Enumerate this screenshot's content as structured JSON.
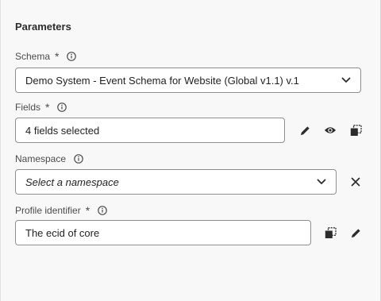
{
  "panel": {
    "heading": "Parameters"
  },
  "schema": {
    "label": "Schema",
    "required_mark": "*",
    "value": "Demo System - Event Schema for Website (Global v1.1) v.1",
    "icons": [
      "info-icon",
      "chevron-down-icon"
    ]
  },
  "fields": {
    "label": "Fields",
    "required_mark": "*",
    "value": "4 fields selected",
    "icons": [
      "info-icon",
      "pencil-icon",
      "eye-icon",
      "copy-icon"
    ]
  },
  "namespace": {
    "label": "Namespace",
    "placeholder": "Select a namespace",
    "icons": [
      "info-icon",
      "chevron-down-icon",
      "close-icon"
    ]
  },
  "profile_identifier": {
    "label": "Profile identifier",
    "required_mark": "*",
    "value": "The ecid of core",
    "icons": [
      "info-icon",
      "copy-icon",
      "pencil-icon"
    ]
  },
  "colors": {
    "background": "#f8f8f8",
    "field_border": "#8f8f8f",
    "text": "#2c2c2c"
  }
}
